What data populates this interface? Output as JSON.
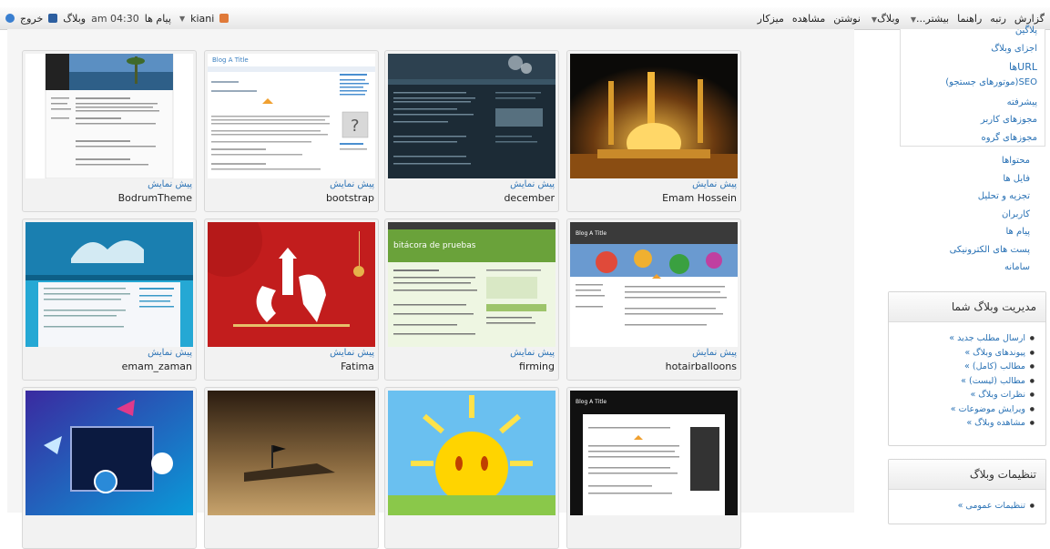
{
  "topbar": {
    "right_items": [
      "میزکار",
      "مشاهده",
      "نوشتن",
      "وبلاگ",
      "بیشتر...",
      "راهنما",
      "رتبه",
      "گزارش"
    ],
    "dropdown_after": [
      "وبلاگ",
      "بیشتر...",
      "راهنما"
    ],
    "left": {
      "logout": "خروج",
      "blog": "وبلاگ",
      "time": "am 04:30",
      "messages": "پیام ها",
      "user": "kiani"
    }
  },
  "themes": [
    {
      "name": "BodrumTheme",
      "preview": "پیش نمایش"
    },
    {
      "name": "bootstrap",
      "preview": "پیش نمایش"
    },
    {
      "name": "december",
      "preview": "پیش نمایش"
    },
    {
      "name": "Emam Hossein",
      "preview": "پیش نمایش"
    },
    {
      "name": "emam_zaman",
      "preview": "پیش نمایش"
    },
    {
      "name": "Fatima",
      "preview": "پیش نمایش"
    },
    {
      "name": "firming",
      "preview": "پیش نمایش"
    },
    {
      "name": "hotairballoons",
      "preview": "پیش نمایش"
    },
    {
      "name": "",
      "preview": ""
    },
    {
      "name": "",
      "preview": ""
    },
    {
      "name": "",
      "preview": ""
    },
    {
      "name": "",
      "preview": ""
    }
  ],
  "thumb_texts": {
    "bootstrap_title": "Blog A Title",
    "firming_title": "bitácora de pruebas",
    "hot_title": "Blog A Title",
    "dark_title": "Blog A Title"
  },
  "sidebar": {
    "submenu": [
      "پلاگین",
      "اجزای وبلاگ",
      "URLها",
      "SEO(موتورهای جستجو)",
      "پیشرفته",
      "مجوزهای کاربر",
      "مجوزهای گروه"
    ],
    "menu": [
      "محتواها",
      "فایل ها",
      "تجزیه و تحلیل",
      "کاربران",
      "پیام ها",
      "پست های الکترونیکی",
      "سامانه"
    ],
    "manage": {
      "title": "مدیریت وبلاگ شما",
      "items": [
        "ارسال مطلب جدید »",
        "پیوندهای وبلاگ »",
        "مطالب (کامل) »",
        "مطالب (لیست) »",
        "نظرات وبلاگ »",
        "ویرایش موضوعات »",
        "مشاهده وبلاگ »"
      ]
    },
    "settings": {
      "title": "تنظیمات وبلاگ",
      "items": [
        "تنظیمات عمومی »"
      ]
    }
  },
  "colors": {
    "link": "#2a72b5",
    "topbar_bg": "#efefef"
  }
}
